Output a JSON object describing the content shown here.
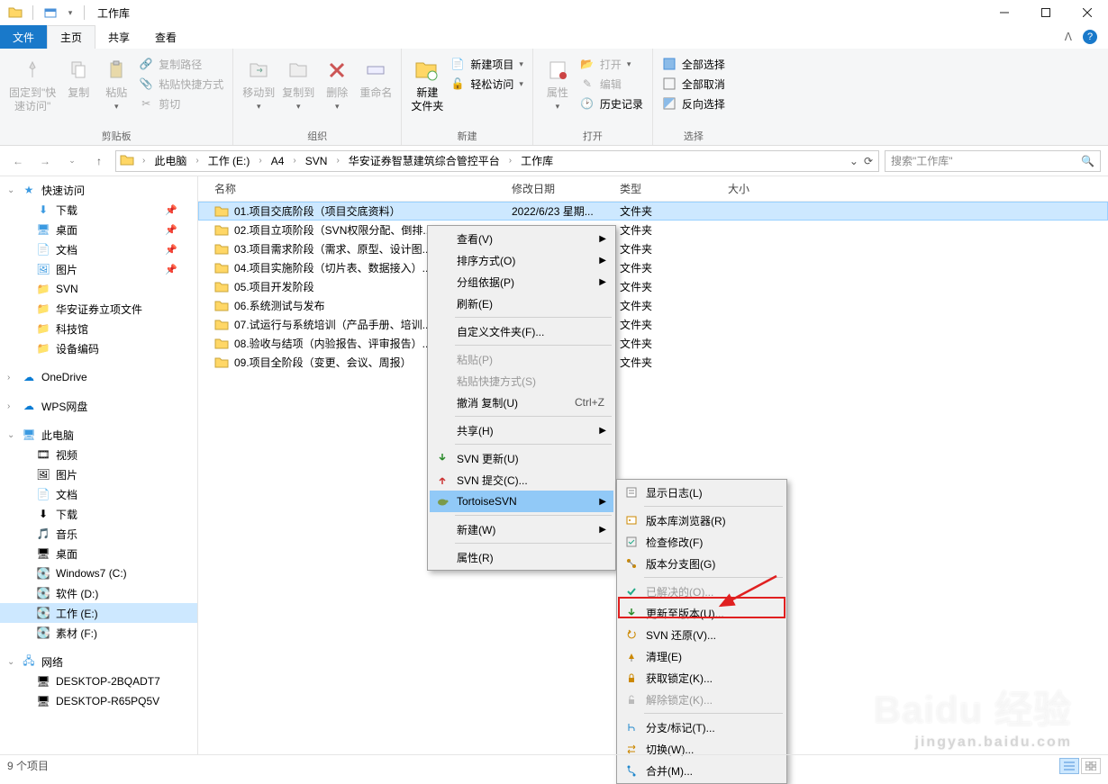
{
  "window": {
    "title": "工作库"
  },
  "tabs": {
    "file": "文件",
    "home": "主页",
    "share": "共享",
    "view": "查看"
  },
  "ribbon": {
    "clipboard": {
      "pin": "固定到\"快\n速访问\"",
      "copy": "复制",
      "paste": "粘贴",
      "copypath": "复制路径",
      "pasteshortcut": "粘贴快捷方式",
      "cut": "剪切",
      "label": "剪贴板"
    },
    "organize": {
      "moveto": "移动到",
      "copyto": "复制到",
      "delete": "删除",
      "rename": "重命名",
      "label": "组织"
    },
    "new": {
      "newfolder": "新建\n文件夹",
      "newitem": "新建项目",
      "easyaccess": "轻松访问",
      "label": "新建"
    },
    "open": {
      "properties": "属性",
      "open": "打开",
      "edit": "编辑",
      "history": "历史记录",
      "label": "打开"
    },
    "select": {
      "selectall": "全部选择",
      "selectnone": "全部取消",
      "invert": "反向选择",
      "label": "选择"
    }
  },
  "breadcrumb": [
    "此电脑",
    "工作 (E:)",
    "A4",
    "SVN",
    "华安证券智慧建筑综合管控平台",
    "工作库"
  ],
  "search": {
    "placeholder": "搜索\"工作库\""
  },
  "nav": {
    "quick": "快速访问",
    "quick_items": [
      "下载",
      "桌面",
      "文档",
      "图片",
      "SVN",
      "华安证券立项文件",
      "科技馆",
      "设备编码"
    ],
    "onedrive": "OneDrive",
    "wps": "WPS网盘",
    "thispc": "此电脑",
    "thispc_items": [
      "视频",
      "图片",
      "文档",
      "下载",
      "音乐",
      "桌面",
      "Windows7 (C:)",
      "软件 (D:)",
      "工作 (E:)",
      "素材 (F:)"
    ],
    "network": "网络",
    "network_items": [
      "DESKTOP-2BQADT7",
      "DESKTOP-R65PQ5V"
    ]
  },
  "columns": {
    "name": "名称",
    "date": "修改日期",
    "type": "类型",
    "size": "大小"
  },
  "files": [
    {
      "name": "01.项目交底阶段（项目交底资料）",
      "date": "2022/6/23 星期...",
      "type": "文件夹"
    },
    {
      "name": "02.项目立项阶段（SVN权限分配、倒排...",
      "date": "",
      "type": "文件夹"
    },
    {
      "name": "03.项目需求阶段（需求、原型、设计图...",
      "date": "",
      "type": "文件夹"
    },
    {
      "name": "04.项目实施阶段（切片表、数据接入）...",
      "date": "",
      "type": "文件夹"
    },
    {
      "name": "05.项目开发阶段",
      "date": "",
      "type": "文件夹"
    },
    {
      "name": "06.系统测试与发布",
      "date": "",
      "type": "文件夹"
    },
    {
      "name": "07.试运行与系统培训（产品手册、培训...",
      "date": "",
      "type": "文件夹"
    },
    {
      "name": "08.验收与结项（内验报告、评审报告）...",
      "date": "",
      "type": "文件夹"
    },
    {
      "name": "09.项目全阶段（变更、会议、周报）",
      "date": "",
      "type": "文件夹"
    }
  ],
  "menu1": [
    {
      "label": "查看(V)",
      "arrow": true
    },
    {
      "label": "排序方式(O)",
      "arrow": true
    },
    {
      "label": "分组依据(P)",
      "arrow": true
    },
    {
      "label": "刷新(E)"
    },
    {
      "sep": true
    },
    {
      "label": "自定义文件夹(F)..."
    },
    {
      "sep": true
    },
    {
      "label": "粘贴(P)",
      "dim": true
    },
    {
      "label": "粘贴快捷方式(S)",
      "dim": true
    },
    {
      "label": "撤消 复制(U)",
      "shortcut": "Ctrl+Z"
    },
    {
      "sep": true
    },
    {
      "label": "共享(H)",
      "arrow": true
    },
    {
      "sep": true
    },
    {
      "label": "SVN 更新(U)",
      "icon": "svn-update"
    },
    {
      "label": "SVN 提交(C)...",
      "icon": "svn-commit"
    },
    {
      "label": "TortoiseSVN",
      "arrow": true,
      "icon": "tortoise",
      "hover": true
    },
    {
      "sep": true
    },
    {
      "label": "新建(W)",
      "arrow": true
    },
    {
      "sep": true
    },
    {
      "label": "属性(R)"
    }
  ],
  "menu2": [
    {
      "label": "显示日志(L)",
      "icon": "log"
    },
    {
      "sep": true
    },
    {
      "label": "版本库浏览器(R)",
      "icon": "repo-browser"
    },
    {
      "label": "检查修改(F)",
      "icon": "check-mod"
    },
    {
      "label": "版本分支图(G)",
      "icon": "branch-graph"
    },
    {
      "sep": true
    },
    {
      "label": "已解决的(O)...",
      "icon": "resolved",
      "dim": true
    },
    {
      "label": "更新至版本(U)...",
      "icon": "update-rev",
      "highlight": true
    },
    {
      "label": "SVN 还原(V)...",
      "icon": "revert"
    },
    {
      "label": "清理(E)",
      "icon": "cleanup"
    },
    {
      "label": "获取锁定(K)...",
      "icon": "lock"
    },
    {
      "label": "解除锁定(K)...",
      "icon": "unlock",
      "dim": true
    },
    {
      "sep": true
    },
    {
      "label": "分支/标记(T)...",
      "icon": "branch"
    },
    {
      "label": "切换(W)...",
      "icon": "switch"
    },
    {
      "label": "合并(M)...",
      "icon": "merge"
    }
  ],
  "status": {
    "count": "9 个项目"
  },
  "watermark": {
    "l1": "Baidu 经验",
    "l2": "jingyan.baidu.com"
  }
}
